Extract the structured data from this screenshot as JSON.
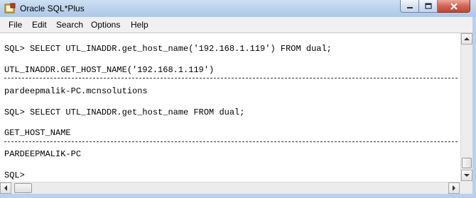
{
  "window": {
    "title": "Oracle SQL*Plus",
    "icon": "sqlplus-app-icon",
    "controls": [
      "minimize-icon",
      "maximize-icon",
      "close-icon"
    ]
  },
  "menu": [
    "File",
    "Edit",
    "Search",
    "Options",
    "Help"
  ],
  "console": {
    "lines": [
      "SQL> SELECT UTL_INADDR.get_host_name('192.168.1.119') FROM dual;",
      "UTL_INADDR.GET_HOST_NAME('192.168.1.119')",
      "pardeepmalik-PC.mcnsolutions",
      "SQL> SELECT UTL_INADDR.get_host_name FROM dual;",
      "GET_HOST_NAME",
      "PARDEEPMALIK-PC",
      "SQL>"
    ]
  },
  "colors": {
    "titlebar": "#b9d1ec",
    "close_button": "#d7624f"
  }
}
